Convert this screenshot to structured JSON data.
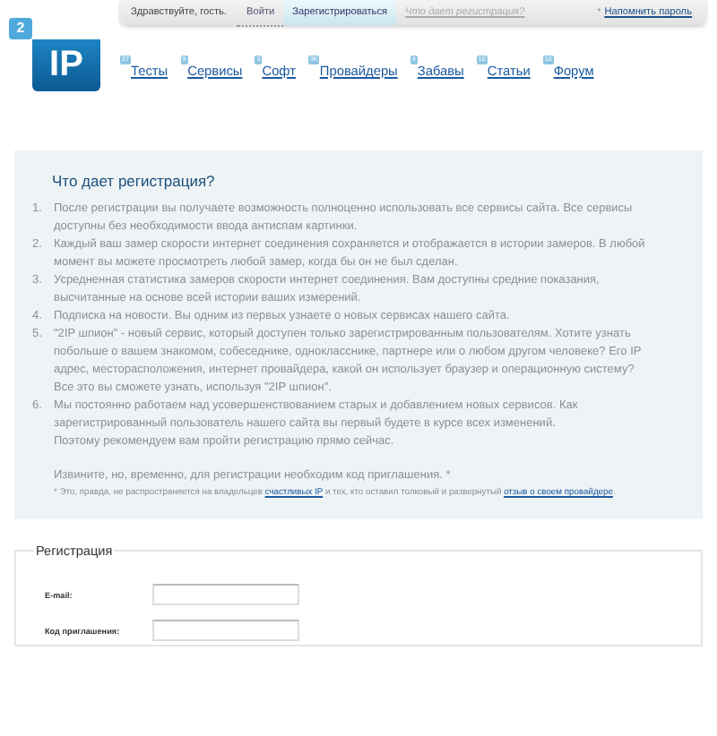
{
  "top_bar": {
    "greeting": "Здравствуйте, гость.",
    "tabs": [
      {
        "label": "Войти",
        "selected": false
      },
      {
        "label": "Зарегистрироваться",
        "selected": true
      }
    ],
    "hint_link": "Что дает регистрация?",
    "remind": {
      "mark": "*",
      "label": "Напомнить пароль"
    }
  },
  "logo": {
    "badge": "2",
    "text": "IP"
  },
  "nav": [
    {
      "label": "Тесты",
      "count": "27"
    },
    {
      "label": "Сервисы",
      "count": "9"
    },
    {
      "label": "Софт",
      "count": "5"
    },
    {
      "label": "Провайдеры",
      "count": "3K"
    },
    {
      "label": "Забавы",
      "count": "4"
    },
    {
      "label": "Статьи",
      "count": "10"
    },
    {
      "label": "Форум",
      "count": "10"
    }
  ],
  "info": {
    "title": "Что дает регистрация?",
    "items": [
      {
        "number": "1.",
        "paragraphs": [
          "После регистрации вы получаете возможность полноценно использовать все сервисы сайта. Все сервисы доступны без необходимости ввода антиспам картинки."
        ]
      },
      {
        "number": "2.",
        "paragraphs": [
          "Каждый ваш замер скорости интернет соединения сохраняется и отображается в истории замеров. В любой момент вы можете просмотреть любой замер, когда бы он не был сделан."
        ]
      },
      {
        "number": "3.",
        "paragraphs": [
          "Усредненная статистика замеров скорости интернет соединения. Вам доступны средние показания, высчитанные на основе всей истории ваших измерений."
        ]
      },
      {
        "number": "4.",
        "paragraphs": [
          "Подписка на новости. Вы одним из первых узнаете о новых сервисах нашего сайта."
        ]
      },
      {
        "number": "5.",
        "paragraphs": [
          "\"2IP шпион\" - новый сервис, который доступен только зарегистрированным пользователям. Хотите узнать побольше о вашем знакомом, собеседнике, однокласснике, партнере или о любом другом человеке? Его IP адрес, месторасположения, интернет провайдера, какой он использует браузер и операционную систему? Все это вы сможете узнать, используя \"2IP шпион\"."
        ]
      },
      {
        "number": "6.",
        "paragraphs": [
          "Мы постоянно работаем над усовершенствованием старых и добавлением новых сервисов. Как зарегистрированный пользователь нашего сайта вы первый будете в курсе всех изменений.",
          "Поэтому рекомендуем вам пройти регистрацию прямо сейчас."
        ]
      }
    ],
    "notice": "Извините, но, временно, для регистрации необходим код приглашения. *",
    "footnote": [
      {
        "kind": "text",
        "text": "* Это, правда, не распространяется на владельцев "
      },
      {
        "kind": "link",
        "text": "счастливых IP"
      },
      {
        "kind": "text",
        "text": " и тех, кто оставил толковый и развернутый "
      },
      {
        "kind": "link",
        "text": "отзыв о своем провайдере"
      },
      {
        "kind": "text",
        "text": "."
      }
    ]
  },
  "registration": {
    "legend": "Регистрация",
    "fields": [
      {
        "label": "E-mail:"
      },
      {
        "label": "Код приглашения:"
      }
    ]
  }
}
